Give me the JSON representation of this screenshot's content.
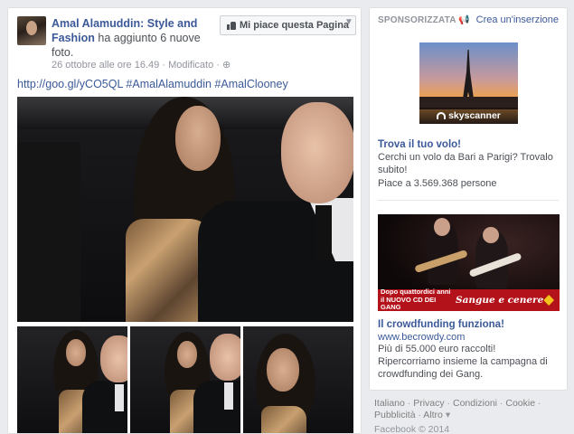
{
  "post": {
    "page_name": "Amal Alamuddin: Style and Fashion",
    "action": "ha aggiunto 6 nuove foto.",
    "timestamp": "26 ottobre alle ore 16.49",
    "edited": "Modificato",
    "privacy_icon": "globe-icon",
    "like_button": "Mi piace questa Pagina",
    "menu_icon": "chevron-down-icon",
    "text": "http://goo.gl/yCO5QL #AmalAlamuddin #AmalClooney"
  },
  "sidebar": {
    "header": "SPONSORIZZATA",
    "create_ad": "Crea un'inserzione",
    "ads": [
      {
        "image_brand": "skyscanner",
        "title": "Trova il tuo volo!",
        "body": "Cerchi un volo da Bari a Parigi? Trovalo subito!",
        "likes": "Piace a 3.569.368 persone"
      },
      {
        "image_caption_left": "Dopo quattordici anni il NUOVO CD DEI GANG",
        "image_caption_right": "Sangue e cenere",
        "title": "Il crowdfunding funziona!",
        "url": "www.becrowdy.com",
        "body": "Più di 55.000 euro raccolti! Ripercorriamo insieme la campagna di crowdfunding dei Gang."
      }
    ]
  },
  "footer": {
    "links": [
      "Italiano",
      "Privacy",
      "Condizioni",
      "Cookie",
      "Pubblicità",
      "Altro"
    ],
    "copyright": "Facebook © 2014"
  }
}
